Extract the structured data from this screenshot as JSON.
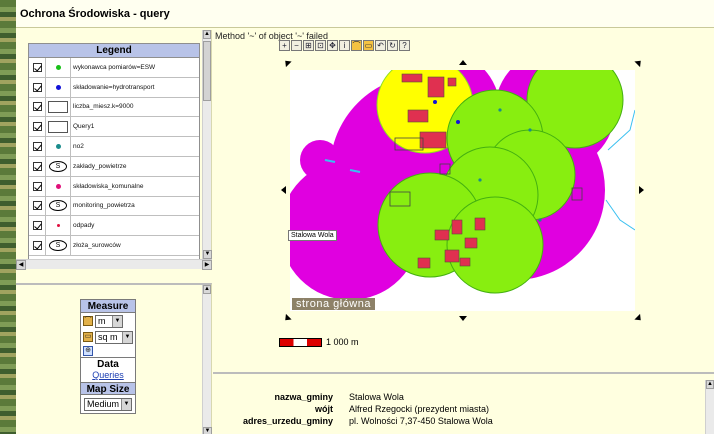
{
  "window": {
    "title": "Ochrona Środowiska - query"
  },
  "legend": {
    "title": "Legend",
    "items": [
      {
        "label": "wykonawca pomiarów=ESW",
        "symbol": "dot",
        "color": "#18c018"
      },
      {
        "label": "składowanie=hydrotransport",
        "symbol": "dot",
        "color": "#1212d8"
      },
      {
        "label": "liczba_miesz.k=9000",
        "symbol": "rect",
        "color": "#ffffff"
      },
      {
        "label": "Query1",
        "symbol": "rect",
        "color": "#ffffff"
      },
      {
        "label": "no2",
        "symbol": "dot",
        "color": "#1a8c8c"
      },
      {
        "label": "zakłady_powietrze",
        "symbol": "ellipse-s",
        "color": "#000000"
      },
      {
        "label": "składowiska_komunalne",
        "symbol": "dot",
        "color": "#e0107a"
      },
      {
        "label": "monitoring_powietrza",
        "symbol": "ellipse-s",
        "color": "#000000"
      },
      {
        "label": "odpady",
        "symbol": "dot-small",
        "color": "#e01040"
      },
      {
        "label": "złoża_surowców",
        "symbol": "ellipse-s",
        "color": "#000000"
      }
    ]
  },
  "tools": {
    "measure_title": "Measure",
    "length_unit": "m",
    "area_unit": "sq m",
    "data_title": "Data",
    "queries_link": "Queries",
    "map_size_title": "Map Size",
    "map_size_value": "Medium"
  },
  "map": {
    "error_message": "Method '~' of object '~' failed",
    "toolbar_icons": [
      "zoom-in-icon",
      "zoom-out-icon",
      "full-extent-icon",
      "zoom-layer-icon",
      "pan-icon",
      "identify-icon",
      "measure-line-icon",
      "measure-area-icon",
      "zoom-previous-icon",
      "refresh-icon",
      "query-icon"
    ],
    "place_label": "Stalowa Wola",
    "banner_text": "strona główna",
    "scale_text": "1 000 m",
    "colors": {
      "buffer_magenta": "#e000e0",
      "buffer_green": "#88ee10",
      "buffer_yellow": "#ffff00",
      "blocks_red": "#e03050",
      "roads": "#3ac0f0"
    }
  },
  "info": {
    "rows": [
      {
        "key": "nazwa_gminy",
        "value": "Stalowa Wola"
      },
      {
        "key": "wójt",
        "value": "Alfred Rzegocki (prezydent miasta)"
      },
      {
        "key": "adres_urzedu_gminy",
        "value": "pl. Wolności 7,37-450 Stalowa Wola"
      }
    ]
  }
}
